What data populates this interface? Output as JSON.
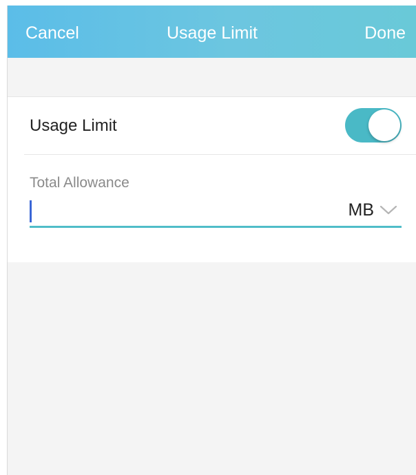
{
  "navbar": {
    "cancel_label": "Cancel",
    "title": "Usage Limit",
    "done_label": "Done"
  },
  "usage_limit": {
    "label": "Usage Limit",
    "enabled": true
  },
  "total_allowance": {
    "label": "Total Allowance",
    "value": "",
    "unit": "MB"
  },
  "colors": {
    "nav_gradient_start": "#5bbde8",
    "nav_gradient_end": "#69c9d8",
    "toggle_on": "#4ab9c6",
    "input_underline": "#4fbdc8",
    "caret": "#3a66d6"
  },
  "icons": {
    "unit_dropdown": "chevron-down-icon"
  }
}
